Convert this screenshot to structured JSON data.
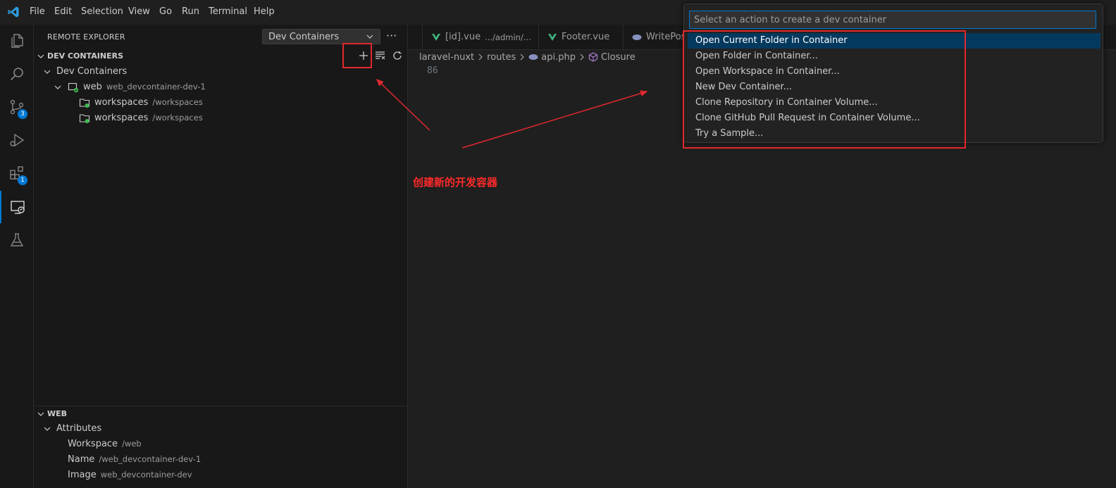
{
  "menu": [
    "File",
    "Edit",
    "Selection",
    "View",
    "Go",
    "Run",
    "Terminal",
    "Help"
  ],
  "activity": {
    "source_control_badge": "3",
    "extensions_badge": "1"
  },
  "sidebar": {
    "title": "REMOTE EXPLORER",
    "view_select": "Dev Containers",
    "more": "···",
    "section_dev": "DEV CONTAINERS",
    "tree": {
      "group": "Dev Containers",
      "container_name": "web",
      "container_desc": "web_devcontainer-dev-1",
      "folders": [
        {
          "name": "workspaces",
          "path": "/workspaces"
        },
        {
          "name": "workspaces",
          "path": "/workspaces"
        }
      ]
    },
    "section_web": "WEB",
    "attributes_label": "Attributes",
    "attributes": [
      {
        "key": "Workspace",
        "value": "/web"
      },
      {
        "key": "Name",
        "value": "/web_devcontainer-dev-1"
      },
      {
        "key": "Image",
        "value": "web_devcontainer-dev"
      }
    ]
  },
  "editor": {
    "tabs": [
      {
        "name": "[id].vue",
        "desc": ".../admin/..."
      },
      {
        "name": "Footer.vue",
        "desc": ""
      },
      {
        "name": "WritePos",
        "desc": ""
      }
    ],
    "breadcrumbs": [
      "laravel-nuxt",
      "routes",
      "api.php",
      "Closure"
    ],
    "line_number": "86"
  },
  "quickpick": {
    "placeholder": "Select an action to create a dev container",
    "items": [
      "Open Current Folder in Container",
      "Open Folder in Container...",
      "Open Workspace in Container...",
      "New Dev Container...",
      "Clone Repository in Container Volume...",
      "Clone GitHub Pull Request in Container Volume...",
      "Try a Sample..."
    ]
  },
  "annotation": {
    "text": "创建新的开发容器",
    "color": "#ff2a2a"
  },
  "colors": {
    "accent": "#0078d4",
    "selection": "#04395e",
    "annotation": "#e0282e",
    "vue_green": "#41b883",
    "php_purple": "#8892bf",
    "status_green": "#3fb950"
  }
}
